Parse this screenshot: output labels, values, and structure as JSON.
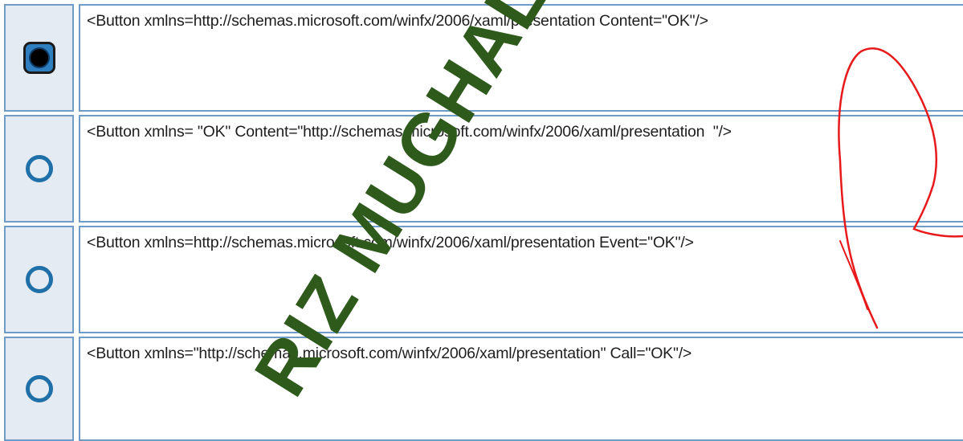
{
  "options": [
    {
      "text": "<Button xmlns=http://schemas.microsoft.com/winfx/2006/xaml/presentation Content=\"OK\"/>",
      "selected": true
    },
    {
      "text": "<Button xmlns= \"OK\" Content=\"http://schemas.microsoft.com/winfx/2006/xaml/presentation  \"/>",
      "selected": false
    },
    {
      "text": "<Button xmlns=http://schemas.microsoft.com/winfx/2006/xaml/presentation Event=\"OK\"/>",
      "selected": false
    },
    {
      "text": "<Button xmlns=\"http://schemas.microsoft.com/winfx/2006/xaml/presentation\" Call=\"OK\"/>",
      "selected": false
    }
  ],
  "watermark": "RIZ MUGHAL",
  "annotation": {
    "mark": "handwritten red loop",
    "color": "#e8191a"
  }
}
